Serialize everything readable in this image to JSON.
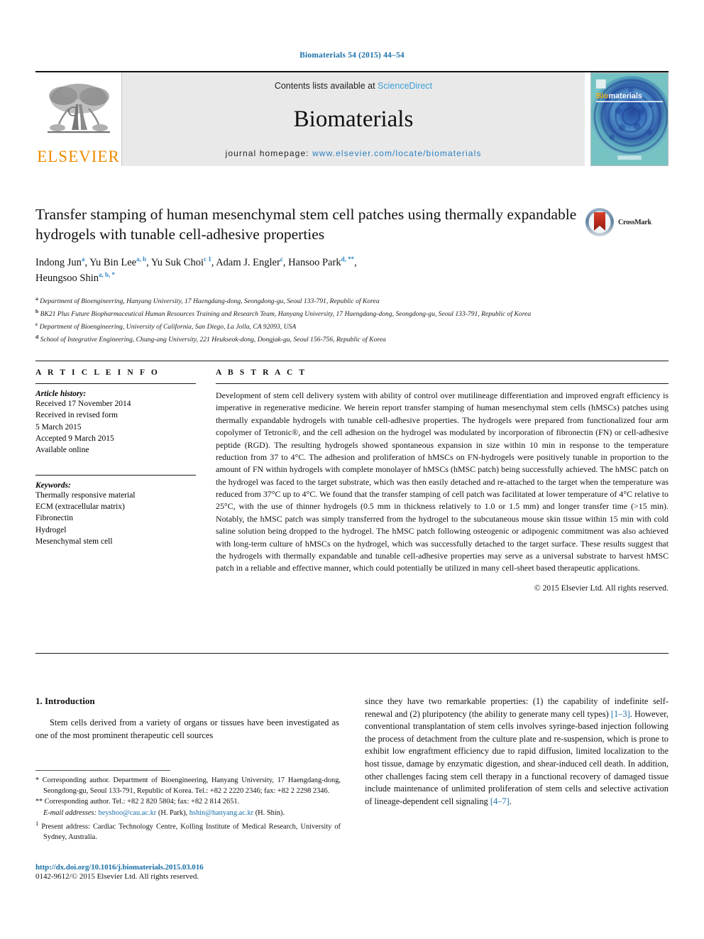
{
  "running_head": "Biomaterials 54 (2015) 44–54",
  "masthead": {
    "publisher_name": "ELSEVIER",
    "contents_prefix": "Contents lists available at",
    "sciencedirect": "ScienceDirect",
    "journal_name": "Biomaterials",
    "homepage_prefix": "journal homepage:",
    "homepage_url": "www.elsevier.com/locate/biomaterials",
    "cover_title_first": "Bio",
    "cover_title_rest": "materials",
    "colors": {
      "elsevier_orange": "#ED8B00",
      "link_blue": "#2b7fc0",
      "sciencedirect_blue": "#3d9fd6",
      "band_gray": "#e9e9e9",
      "cover_teal": "#6fbfc4",
      "cover_blue": "#2a52a0"
    }
  },
  "article": {
    "title": "Transfer stamping of human mesenchymal stem cell patches using thermally expandable hydrogels with tunable cell-adhesive properties",
    "crossmark_label": "CrossMark",
    "authors_line_1": "Indong Jun <a>, Yu Bin Lee <a, b>, Yu Suk Choi <c 1>, Adam J. Engler <c>, Hansoo Park <d, **>,",
    "authors_line_2": "Heungsoo Shin <a, b, *>",
    "authors": [
      {
        "name": "Indong Jun",
        "marks": "a"
      },
      {
        "name": "Yu Bin Lee",
        "marks": "a, b"
      },
      {
        "name": "Yu Suk Choi",
        "marks": "c 1"
      },
      {
        "name": "Adam J. Engler",
        "marks": "c"
      },
      {
        "name": "Hansoo Park",
        "marks": "d, **"
      },
      {
        "name": "Heungsoo Shin",
        "marks": "a, b, *"
      }
    ],
    "affiliations": [
      {
        "mark": "a",
        "text": "Department of Bioengineering, Hanyang University, 17 Haengdang-dong, Seongdong-gu, Seoul 133-791, Republic of Korea"
      },
      {
        "mark": "b",
        "text": "BK21 Plus Future Biopharmaceutical Human Resources Training and Research Team, Hanyang University, 17 Haengdang-dong, Seongdong-gu, Seoul 133-791, Republic of Korea"
      },
      {
        "mark": "c",
        "text": "Department of Bioengineering, University of California, San Diego, La Jolla, CA 92093, USA"
      },
      {
        "mark": "d",
        "text": "School of Integrative Engineering, Chung-ang University, 221 Heukseok-dong, Dongjak-gu, Seoul 156-756, Republic of Korea"
      }
    ]
  },
  "article_info": {
    "heading": "A R T I C L E  I N F O",
    "history_label": "Article history:",
    "history": [
      "Received 17 November 2014",
      "Received in revised form",
      "5 March 2015",
      "Accepted 9 March 2015",
      "Available online"
    ],
    "keywords_label": "Keywords:",
    "keywords": [
      "Thermally responsive material",
      "ECM (extracellular matrix)",
      "Fibronectin",
      "Hydrogel",
      "Mesenchymal stem cell"
    ]
  },
  "abstract": {
    "heading": "A B S T R A C T",
    "text": "Development of stem cell delivery system with ability of control over mutilineage differentiation and improved engraft efficiency is imperative in regenerative medicine. We herein report transfer stamping of human mesenchymal stem cells (hMSCs) patches using thermally expandable hydrogels with tunable cell-adhesive properties. The hydrogels were prepared from functionalized four arm copolymer of Tetronic®, and the cell adhesion on the hydrogel was modulated by incorporation of fibronectin (FN) or cell-adhesive peptide (RGD). The resulting hydrogels showed spontaneous expansion in size within 10 min in response to the temperature reduction from 37 to 4°C. The adhesion and proliferation of hMSCs on FN-hydrogels were positively tunable in proportion to the amount of FN within hydrogels with complete monolayer of hMSCs (hMSC patch) being successfully achieved. The hMSC patch on the hydrogel was faced to the target substrate, which was then easily detached and re-attached to the target when the temperature was reduced from 37°C up to 4°C. We found that the transfer stamping of cell patch was facilitated at lower temperature of 4°C relative to 25°C, with the use of thinner hydrogels (0.5 mm in thickness relatively to 1.0 or 1.5 mm) and longer transfer time (>15 min). Notably, the hMSC patch was simply transferred from the hydrogel to the subcutaneous mouse skin tissue within 15 min with cold saline solution being dropped to the hydrogel. The hMSC patch following osteogenic or adipogenic commitment was also achieved with long-term culture of hMSCs on the hydrogel, which was successfully detached to the target surface. These results suggest that the hydrogels with thermally expandable and tunable cell-adhesive properties may serve as a universal substrate to harvest hMSC patch in a reliable and effective manner, which could potentially be utilized in many cell-sheet based therapeutic applications.",
    "copyright": "© 2015 Elsevier Ltd. All rights reserved."
  },
  "introduction": {
    "section_number": "1.",
    "section_title": "Introduction",
    "left_paragraph": "Stem cells derived from a variety of organs or tissues have been investigated as one of the most prominent therapeutic cell sources",
    "right_paragraph_a": "since they have two remarkable properties: (1) the capability of indefinite self-renewal and (2) pluripotency (the ability to generate many cell types) ",
    "right_ref_1": "[1–3]",
    "right_paragraph_b": ". However, conventional transplantation of stem cells involves syringe-based injection following the process of detachment from the culture plate and re-suspension, which is prone to exhibit low engraftment efficiency due to rapid diffusion, limited localization to the host tissue, damage by enzymatic digestion, and shear-induced cell death. In addition, other challenges facing stem cell therapy in a functional recovery of damaged tissue include maintenance of unlimited proliferation of stem cells and selective activation of lineage-dependent cell signaling ",
    "right_ref_2": "[4–7]",
    "right_paragraph_c": "."
  },
  "footnotes": {
    "corresponding_1_mark": "*",
    "corresponding_1": "Corresponding author. Department of Bioengineering, Hanyang University, 17 Haengdang-dong, Seongdong-gu, Seoul 133-791, Republic of Korea. Tel.: +82 2 2220 2346; fax: +82 2 2298 2346.",
    "corresponding_2_mark": "**",
    "corresponding_2": "Corresponding author. Tel.: +82 2 820 5804; fax: +82 2 814 2651.",
    "email_label": "E-mail addresses:",
    "email_1": "heyshoo@cau.ac.kr",
    "email_1_owner": "(H. Park),",
    "email_2": "hshin@hanyang.ac.kr",
    "email_2_owner": "(H. Shin).",
    "present_mark": "1",
    "present_address": "Present address: Cardiac Technology Centre, Kolling Institute of Medical Research, University of Sydney, Australia."
  },
  "footer": {
    "doi": "http://dx.doi.org/10.1016/j.biomaterials.2015.03.016",
    "issn_copyright": "0142-9612/© 2015 Elsevier Ltd. All rights reserved."
  }
}
